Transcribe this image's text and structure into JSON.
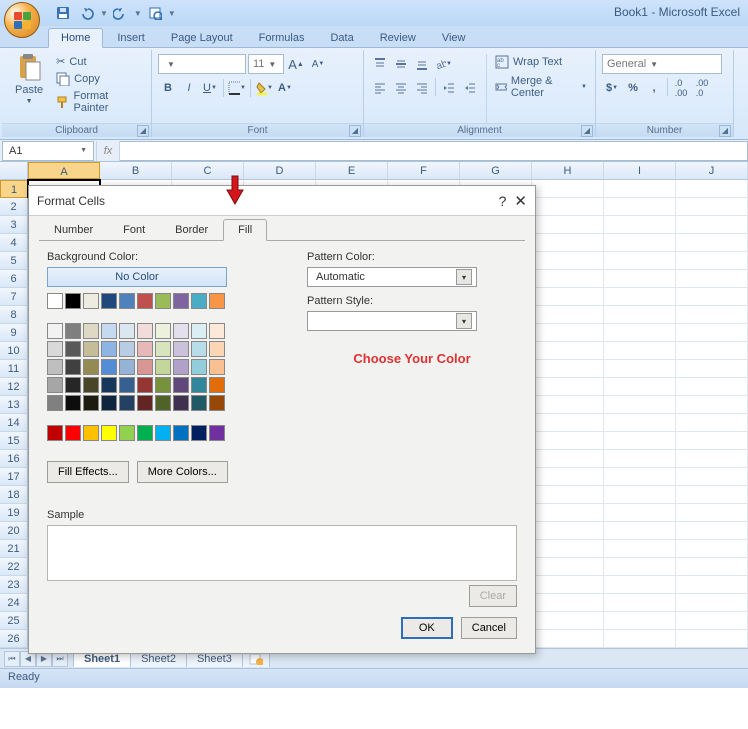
{
  "window": {
    "title": "Book1 - Microsoft Excel"
  },
  "ribbon": {
    "tabs": [
      "Home",
      "Insert",
      "Page Layout",
      "Formulas",
      "Data",
      "Review",
      "View"
    ],
    "active_tab": "Home",
    "clipboard": {
      "paste": "Paste",
      "cut": "Cut",
      "copy": "Copy",
      "painter": "Format Painter",
      "label": "Clipboard"
    },
    "font": {
      "label": "Font",
      "size": "11"
    },
    "alignment": {
      "label": "Alignment",
      "wrap": "Wrap Text",
      "merge": "Merge & Center"
    },
    "number": {
      "label": "Number",
      "format": "General"
    }
  },
  "formulaBar": {
    "name": "A1",
    "fx": "fx"
  },
  "grid": {
    "columns": [
      "A",
      "B",
      "C",
      "D",
      "E",
      "F",
      "G",
      "H",
      "I",
      "J"
    ],
    "rows": 26,
    "active": "A1"
  },
  "sheets": {
    "tabs": [
      "Sheet1",
      "Sheet2",
      "Sheet3"
    ],
    "active": "Sheet1"
  },
  "status": {
    "text": "Ready"
  },
  "dialog": {
    "title": "Format Cells",
    "tabs": [
      "Number",
      "Font",
      "Border",
      "Fill"
    ],
    "active_tab": "Fill",
    "bg_label": "Background Color:",
    "no_color": "No Color",
    "fill_effects": "Fill Effects...",
    "more_colors": "More Colors...",
    "pattern_color_label": "Pattern Color:",
    "pattern_color_value": "Automatic",
    "pattern_style_label": "Pattern Style:",
    "annotation": "Choose Your Color",
    "sample_label": "Sample",
    "clear": "Clear",
    "ok": "OK",
    "cancel": "Cancel",
    "row1": [
      "#ffffff",
      "#000000",
      "#eeece1",
      "#1f497d",
      "#4f81bd",
      "#c0504d",
      "#9bbb59",
      "#8064a2",
      "#4bacc6",
      "#f79646"
    ],
    "theme": [
      [
        "#f2f2f2",
        "#7f7f7f",
        "#ddd9c4",
        "#c5d9f1",
        "#dce6f1",
        "#f2dcdb",
        "#ebf1dd",
        "#e4dfec",
        "#daeef3",
        "#fde9d9"
      ],
      [
        "#d9d9d9",
        "#595959",
        "#c4bd97",
        "#8db4e2",
        "#b8cce4",
        "#e6b8b7",
        "#d8e4bc",
        "#ccc1da",
        "#b7dee8",
        "#fcd5b4"
      ],
      [
        "#bfbfbf",
        "#404040",
        "#948a54",
        "#538dd5",
        "#95b3d7",
        "#da9694",
        "#c4d79b",
        "#b1a0c7",
        "#92cddc",
        "#fac08f"
      ],
      [
        "#a6a6a6",
        "#262626",
        "#494529",
        "#16365c",
        "#366092",
        "#963634",
        "#76933c",
        "#60497a",
        "#31869b",
        "#e26b0a"
      ],
      [
        "#808080",
        "#0d0d0d",
        "#1d1b10",
        "#0f243e",
        "#244062",
        "#632523",
        "#4f6228",
        "#403151",
        "#215967",
        "#974706"
      ]
    ],
    "standard": [
      "#c00000",
      "#ff0000",
      "#ffc000",
      "#ffff00",
      "#92d050",
      "#00b050",
      "#00b0f0",
      "#0070c0",
      "#002060",
      "#7030a0"
    ]
  }
}
